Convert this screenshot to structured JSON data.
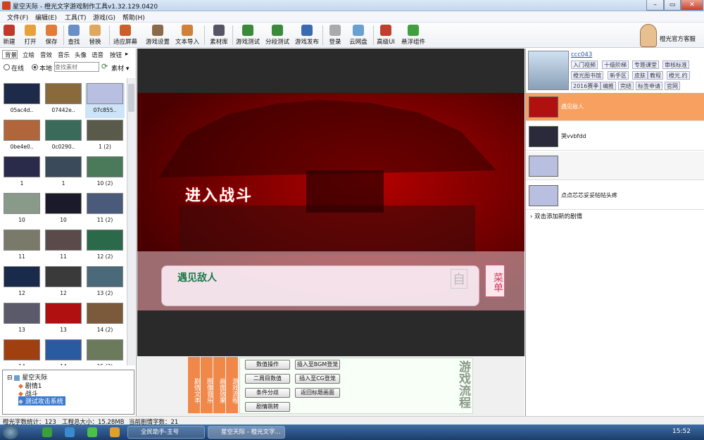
{
  "window": {
    "title": "星空天际 - 橙光文字游戏制作工具v1.32.129.0420"
  },
  "menu": [
    "文件(F)",
    "编辑(E)",
    "工具(T)",
    "游戏(G)",
    "帮助(H)"
  ],
  "toolbar": [
    {
      "label": "新建",
      "color": "#c0392b"
    },
    {
      "label": "打开",
      "color": "#e6a03c"
    },
    {
      "label": "保存",
      "color": "#e07b39"
    },
    {
      "label": "查找",
      "color": "#6a8fc7"
    },
    {
      "label": "替换",
      "color": "#e0a85c"
    },
    {
      "label": "适应屏幕",
      "color": "#c9602a"
    },
    {
      "label": "游戏设置",
      "color": "#8a6a4a"
    },
    {
      "label": "文本导入",
      "color": "#d0803a"
    },
    {
      "label": "素材库",
      "color": "#555566"
    },
    {
      "label": "游戏测试",
      "color": "#3a8a3a"
    },
    {
      "label": "分段测试",
      "color": "#3a8a3a"
    },
    {
      "label": "游戏发布",
      "color": "#3a6ab0"
    },
    {
      "label": "登录",
      "color": "#aaaaaa"
    },
    {
      "label": "云网盘",
      "color": "#6aa0d0"
    },
    {
      "label": "高级UI",
      "color": "#c04030"
    },
    {
      "label": "悬浮组件",
      "color": "#40a040"
    }
  ],
  "official": "橙光官方客服",
  "left": {
    "tabs": [
      "背景",
      "立绘",
      "音效",
      "音乐",
      "头像",
      "语音",
      "按钮"
    ],
    "source_online": "在线",
    "source_local": "本地",
    "search_placeholder": "查找素材",
    "material": "素材",
    "thumbs": [
      {
        "name": "05ac4d..",
        "c": "#1d2a4a"
      },
      {
        "name": "07442e..",
        "c": "#8a6a3a"
      },
      {
        "name": "07c855..",
        "c": "#b8bfe0"
      },
      {
        "name": "0be4e0..",
        "c": "#b0653a"
      },
      {
        "name": "0c0290..",
        "c": "#3a6a5a"
      },
      {
        "name": "1 (2)",
        "c": "#5a5a4a"
      },
      {
        "name": "1",
        "c": "#2a2a4a"
      },
      {
        "name": "1",
        "c": "#3a4a5a"
      },
      {
        "name": "10 (2)",
        "c": "#4a7a5a"
      },
      {
        "name": "10",
        "c": "#8a9a8a"
      },
      {
        "name": "10",
        "c": "#1a1a2a"
      },
      {
        "name": "11 (2)",
        "c": "#4a5a7a"
      },
      {
        "name": "11",
        "c": "#7a7a6a"
      },
      {
        "name": "11",
        "c": "#5a4a4a"
      },
      {
        "name": "12 (2)",
        "c": "#2a6a4a"
      },
      {
        "name": "12",
        "c": "#1a2a4a"
      },
      {
        "name": "12",
        "c": "#3a3a3a"
      },
      {
        "name": "13 (2)",
        "c": "#4a6a7a"
      },
      {
        "name": "13",
        "c": "#5a5a6a"
      },
      {
        "name": "13",
        "c": "#b01010"
      },
      {
        "name": "14 (2)",
        "c": "#7a5a3a"
      },
      {
        "name": "14",
        "c": "#a04010"
      },
      {
        "name": "14",
        "c": "#2a5aa0"
      },
      {
        "name": "15 (2)",
        "c": "#6a7a5a"
      }
    ],
    "tree": {
      "root": "星空天际",
      "items": [
        "剧情1",
        "战斗",
        "测试攻击系统"
      ]
    }
  },
  "scene": {
    "banner": "进入战斗",
    "dialog": "遇见敌人",
    "auto": "自",
    "menu": "菜单"
  },
  "bottom": {
    "tabs": [
      "剧情文本",
      "图像音乐",
      "画面效果",
      "游戏流程"
    ],
    "buttons": [
      "数值操作",
      "插入至BGM登笼",
      "二周目数值",
      "插入至CG登笼",
      "条件分歧",
      "返回标题画面",
      "剧情跳转"
    ],
    "logo": "游戏流程"
  },
  "right": {
    "user": "ccc043",
    "tags": [
      "入门视频",
      "十级阶梯",
      "专题课堂",
      "审核标准",
      "橙光图书馆",
      "新手区",
      "皮肤",
      "教程",
      "橙光.约",
      "2016赛季",
      "编推",
      "完结",
      "标签申请",
      "官网"
    ],
    "plots": [
      {
        "label": "遇见敌人",
        "c": "#b01010"
      },
      {
        "label": "哭vvbfdd",
        "c": "#2a2a3a"
      },
      {
        "label": "",
        "c": "#b8bfe0"
      },
      {
        "label": "点点芯芯妥妥帖帖头疼",
        "c": "#b8bfe0"
      }
    ],
    "add_label": "双击添加新的剧情"
  },
  "status": {
    "words": "橙光字数统计：123",
    "size": "工程总大小：15.28MB",
    "current": "当前剧情字数：21"
  },
  "taskbar": {
    "tasks": [
      "全民助手-主号",
      "星空天际 - 橙光文字..."
    ],
    "time": "15:52"
  }
}
